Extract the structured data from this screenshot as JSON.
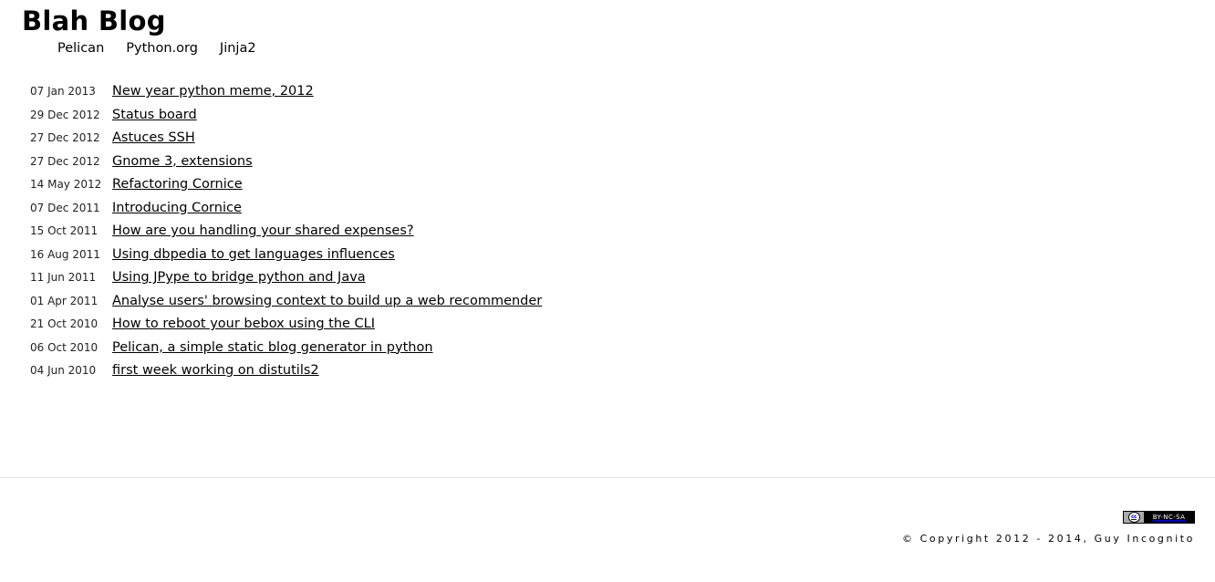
{
  "site": {
    "title": "Blah Blog"
  },
  "nav": [
    {
      "label": "Pelican"
    },
    {
      "label": "Python.org"
    },
    {
      "label": "Jinja2"
    }
  ],
  "posts": [
    {
      "date": "07 Jan 2013",
      "title": "New year python meme, 2012"
    },
    {
      "date": "29 Dec 2012",
      "title": "Status board"
    },
    {
      "date": "27 Dec 2012",
      "title": "Astuces SSH"
    },
    {
      "date": "27 Dec 2012",
      "title": "Gnome 3, extensions"
    },
    {
      "date": "14 May 2012",
      "title": "Refactoring Cornice"
    },
    {
      "date": "07 Dec 2011",
      "title": "Introducing Cornice"
    },
    {
      "date": "15 Oct 2011",
      "title": "How are you handling your shared expenses?"
    },
    {
      "date": "16 Aug 2011",
      "title": "Using dbpedia to get languages influences"
    },
    {
      "date": "11 Jun 2011",
      "title": "Using JPype to bridge python and Java"
    },
    {
      "date": "01 Apr 2011",
      "title": "Analyse users' browsing context to build up a web recommender"
    },
    {
      "date": "21 Oct 2010",
      "title": "How to reboot your bebox using the CLI"
    },
    {
      "date": "06 Oct 2010",
      "title": "Pelican, a simple static blog generator in python"
    },
    {
      "date": "04 Jun 2010",
      "title": "first week working on distutils2"
    }
  ],
  "footer": {
    "license_badge": {
      "icon": "creative-commons-icon",
      "cc_text": "cc",
      "terms_text": "BY-NC-SA"
    },
    "copyright": "© Copyright 2012 - 2014, Guy Incognito"
  }
}
